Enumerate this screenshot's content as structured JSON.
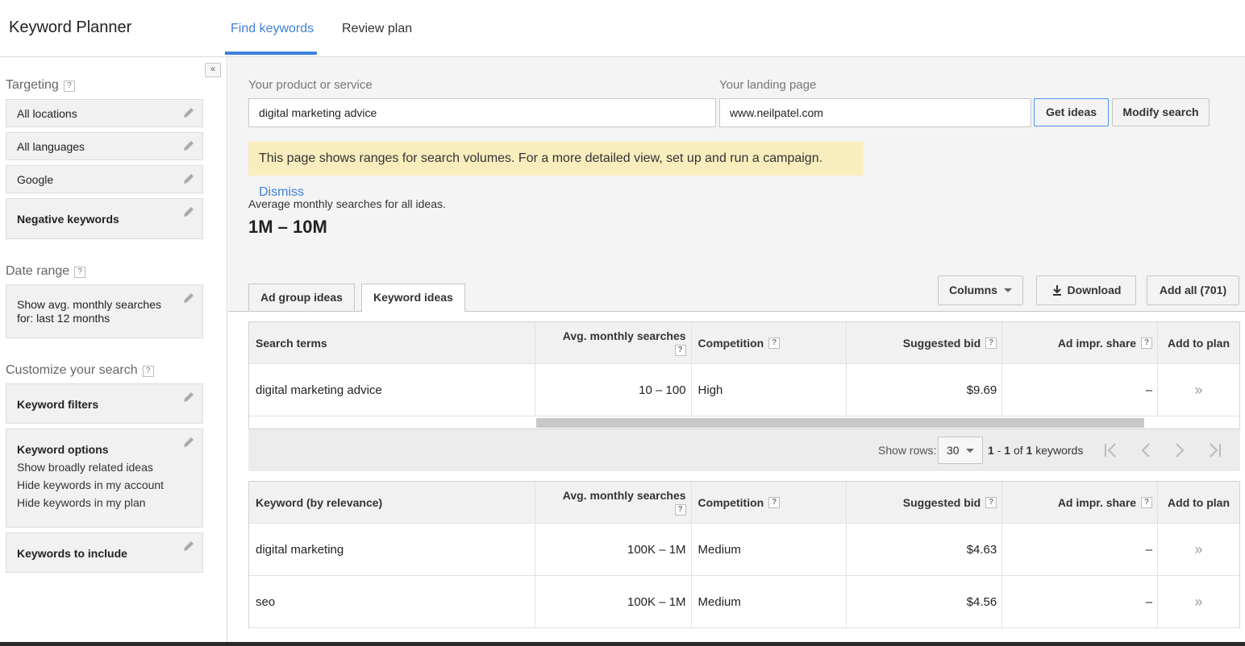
{
  "header": {
    "app_title": "Keyword Planner",
    "tabs": [
      {
        "label": "Find keywords",
        "active": true
      },
      {
        "label": "Review plan",
        "active": false
      }
    ]
  },
  "sidebar": {
    "targeting": {
      "label": "Targeting",
      "items": [
        "All locations",
        "All languages",
        "Google",
        "Negative keywords"
      ]
    },
    "date_range": {
      "label": "Date range",
      "value": "Show avg. monthly searches for: last 12 months"
    },
    "customize": {
      "label": "Customize your search",
      "keyword_filters": "Keyword filters",
      "keyword_options": {
        "title": "Keyword options",
        "lines": [
          "Show broadly related ideas",
          "Hide keywords in my account",
          "Hide keywords in my plan"
        ]
      },
      "keywords_to_include": "Keywords to include"
    }
  },
  "search": {
    "product_label": "Your product or service",
    "product_value": "digital marketing advice",
    "landing_label": "Your landing page",
    "landing_value": "www.neilpatel.com",
    "get_ideas": "Get ideas",
    "modify_search": "Modify search"
  },
  "notice": {
    "text": "This page shows ranges for search volumes. For a more detailed view, set up and run a campaign.",
    "dismiss": "Dismiss"
  },
  "summary": {
    "label": "Average monthly searches for all ideas.",
    "value": "1M – 10M"
  },
  "results_tabs": {
    "ad_group": "Ad group ideas",
    "keyword": "Keyword ideas",
    "active": "keyword"
  },
  "toolbar": {
    "columns": "Columns",
    "download": "Download",
    "add_all": "Add all (701)"
  },
  "search_terms_table": {
    "headers": [
      "Search terms",
      "Avg. monthly searches",
      "Competition",
      "Suggested bid",
      "Ad impr. share",
      "Add to plan"
    ],
    "rows": [
      {
        "term": "digital marketing advice",
        "searches": "10 – 100",
        "competition": "High",
        "bid": "$9.69",
        "share": "–"
      }
    ]
  },
  "pager": {
    "show_rows_label": "Show rows:",
    "rows_value": "30",
    "range_start": "1",
    "range_sep": "-",
    "range_end": "1",
    "of": "of",
    "total": "1",
    "unit": "keywords"
  },
  "keyword_table": {
    "headers": [
      "Keyword (by relevance)",
      "Avg. monthly searches",
      "Competition",
      "Suggested bid",
      "Ad impr. share",
      "Add to plan"
    ],
    "rows": [
      {
        "term": "digital marketing",
        "searches": "100K – 1M",
        "competition": "Medium",
        "bid": "$4.63",
        "share": "–"
      },
      {
        "term": "seo",
        "searches": "100K – 1M",
        "competition": "Medium",
        "bid": "$4.56",
        "share": "–"
      }
    ]
  },
  "glyphs": {
    "help": "?",
    "collapse": "«",
    "add": "»"
  },
  "colors": {
    "accent": "#3d82db",
    "notice_bg": "#f9edbe",
    "panel_bg": "#f4f4f4"
  }
}
